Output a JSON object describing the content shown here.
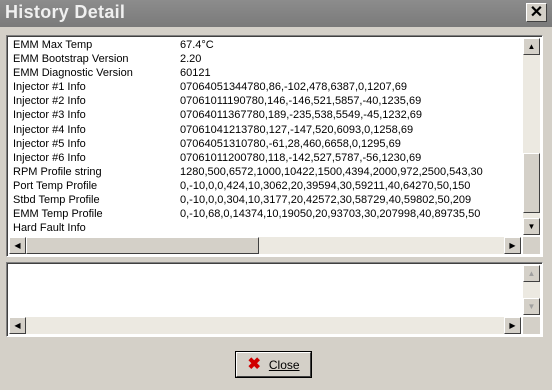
{
  "window": {
    "title": "History Detail",
    "close_glyph": "✕"
  },
  "details": [
    {
      "key": "EMM Max Temp",
      "value": "67.4°C"
    },
    {
      "key": "EMM Bootstrap Version",
      "value": "2.20"
    },
    {
      "key": "EMM Diagnostic Version",
      "value": "60121"
    },
    {
      "key": "Injector #1 Info",
      "value": "07064051344780,86,-102,478,6387,0,1207,69"
    },
    {
      "key": "Injector #2 Info",
      "value": "07061011190780,146,-146,521,5857,-40,1235,69"
    },
    {
      "key": "Injector #3 Info",
      "value": "07064011367780,189,-235,538,5549,-45,1232,69"
    },
    {
      "key": "Injector #4 Info",
      "value": "07061041213780,127,-147,520,6093,0,1258,69"
    },
    {
      "key": "Injector #5 Info",
      "value": "07064051310780,-61,28,460,6658,0,1295,69"
    },
    {
      "key": "Injector #6 Info",
      "value": "07061011200780,118,-142,527,5787,-56,1230,69"
    },
    {
      "key": "RPM Profile string",
      "value": "1280,500,6572,1000,10422,1500,4394,2000,972,2500,543,30"
    },
    {
      "key": "Port Temp Profile",
      "value": "0,-10,0,0,424,10,3062,20,39594,30,59211,40,64270,50,150"
    },
    {
      "key": "Stbd Temp Profile",
      "value": "0,-10,0,0,304,10,3177,20,42572,30,58729,40,59802,50,209"
    },
    {
      "key": "EMM Temp Profile",
      "value": "0,-10,68,0,14374,10,19050,20,93703,30,207998,40,89735,50"
    },
    {
      "key": "Hard Fault Info",
      "value": ""
    }
  ],
  "scroll": {
    "up": "▲",
    "down": "▼",
    "left": "◀",
    "right": "▶"
  },
  "close_button": {
    "icon": "✖",
    "label": "Close"
  }
}
